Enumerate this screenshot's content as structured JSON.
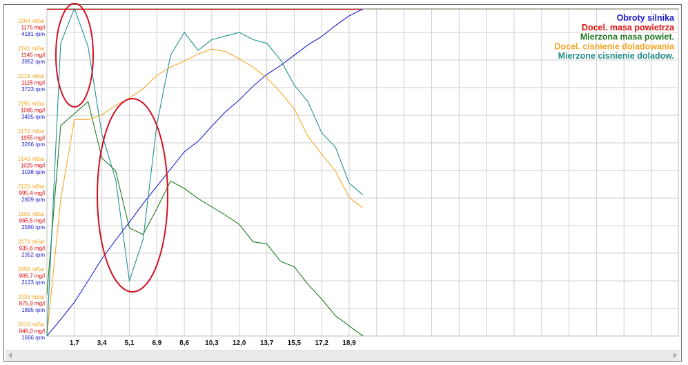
{
  "chart_data": {
    "type": "line",
    "title": "",
    "xlabel": "",
    "grid": true,
    "legend_position": "top-right",
    "x_tick_labels": [
      "1,7",
      "3,4",
      "5,1",
      "6,9",
      "8,6",
      "10,3",
      "12,0",
      "13,7",
      "15,5",
      "17,2",
      "18,9"
    ],
    "x_tick_values": [
      1.719,
      3.438,
      5.157,
      6.876,
      8.595,
      10.314,
      12.033,
      13.752,
      15.471,
      17.19,
      18.909
    ],
    "xlim": [
      0,
      39.5
    ],
    "x": [
      0,
      0.86,
      1.719,
      2.579,
      3.438,
      4.298,
      5.157,
      6.017,
      6.876,
      7.736,
      8.595,
      9.455,
      10.314,
      11.174,
      12.033,
      12.893,
      13.752,
      14.612,
      15.471,
      16.331,
      17.19,
      18.05,
      18.909,
      19.769
    ],
    "y_axes": [
      {
        "name": "boost",
        "unit": "mBar",
        "color": "#f5a623",
        "min": 2010,
        "step": 23.09,
        "tick_labels": [
          "2010 mBar",
          "2033 mBar",
          "2056 mBar",
          "2079 mBar",
          "2102 mBar",
          "2126 mBar",
          "2149 mBar",
          "2172 mBar",
          "2195 mBar",
          "2218 mBar",
          "2241 mBar",
          "2264 mBar"
        ]
      },
      {
        "name": "mass",
        "unit": "mg/l",
        "color": "#e00000",
        "min": 846.0,
        "step": 29.91,
        "tick_labels": [
          "846,0 mg/l",
          "875,9 mg/l",
          "905,7 mg/l",
          "935,6 mg/l",
          "965,5 mg/l",
          "995,4 mg/l",
          "1025 mg/l",
          "1055 mg/l",
          "1085 mg/l",
          "1115 mg/l",
          "1145 mg/l",
          "1175 mg/l"
        ]
      },
      {
        "name": "rpm",
        "unit": "rpm",
        "color": "#1a1acc",
        "min": 1666,
        "step": 228.6,
        "tick_labels": [
          "1666 rpm",
          "1895 rpm",
          "2123 rpm",
          "2352 rpm",
          "2580 rpm",
          "2809 rpm",
          "3038 rpm",
          "3266 rpm",
          "3495 rpm",
          "3723 rpm",
          "3952 rpm",
          "4181 rpm"
        ]
      }
    ],
    "series": [
      {
        "name": "Obroty silnika",
        "axis": "rpm",
        "color": "#2020d0",
        "values": [
          1666,
          1803,
          1946,
          2123,
          2306,
          2461,
          2609,
          2763,
          2906,
          3049,
          3192,
          3278,
          3404,
          3524,
          3621,
          3735,
          3832,
          3907,
          3992,
          4078,
          4147,
          4238,
          4318,
          4375
        ]
      },
      {
        "name": "Docel. masa powietrza",
        "axis": "mass",
        "color": "#d01010",
        "values": [
          1200,
          1200,
          1200,
          1200,
          1200,
          1200,
          1200,
          1200,
          1200,
          1200,
          1200,
          1200,
          1200,
          1200,
          1200,
          1200,
          1200,
          1200,
          1200,
          1200,
          1200,
          1200,
          1200,
          1200
        ]
      },
      {
        "name": "Mierzona masa powiet.",
        "axis": "mass",
        "color": "#1e7a1e",
        "values": [
          891,
          1074,
          1087,
          1100,
          1039,
          1025,
          963,
          956,
          984,
          1014,
          1006,
          995,
          986,
          977,
          967,
          948,
          946,
          927,
          921,
          902,
          886,
          868,
          857,
          846
        ]
      },
      {
        "name": "Docel. cisnienie doladowania",
        "axis": "boost",
        "color": "#f5a623",
        "values": [
          2010,
          2124,
          2191,
          2191,
          2195,
          2203,
          2209,
          2217,
          2228,
          2235,
          2240,
          2246,
          2250,
          2248,
          2242,
          2235,
          2226,
          2214,
          2200,
          2177,
          2162,
          2148,
          2126,
          2117
        ]
      },
      {
        "name": "Mierzone cisnienie doladow.",
        "axis": "boost",
        "color": "#1f9090",
        "values": [
          2010,
          2255,
          2284,
          2252,
          2179,
          2141,
          2056,
          2091,
          2187,
          2245,
          2264,
          2249,
          2258,
          2261,
          2264,
          2258,
          2255,
          2241,
          2220,
          2206,
          2180,
          2168,
          2138,
          2128
        ]
      }
    ],
    "legend": [
      {
        "label": "Obroty silnika",
        "color": "#1a1acc"
      },
      {
        "label": "Docel. masa powietrza",
        "color": "#e01010"
      },
      {
        "label": "Mierzona masa powiet.",
        "color": "#1e7a1e"
      },
      {
        "label": "Docel. cisnienie doladowania",
        "color": "#f5a623"
      },
      {
        "label": "Mierzone cisnienie doladow.",
        "color": "#1f8a8a"
      }
    ],
    "annotation_color": "#d01020"
  }
}
